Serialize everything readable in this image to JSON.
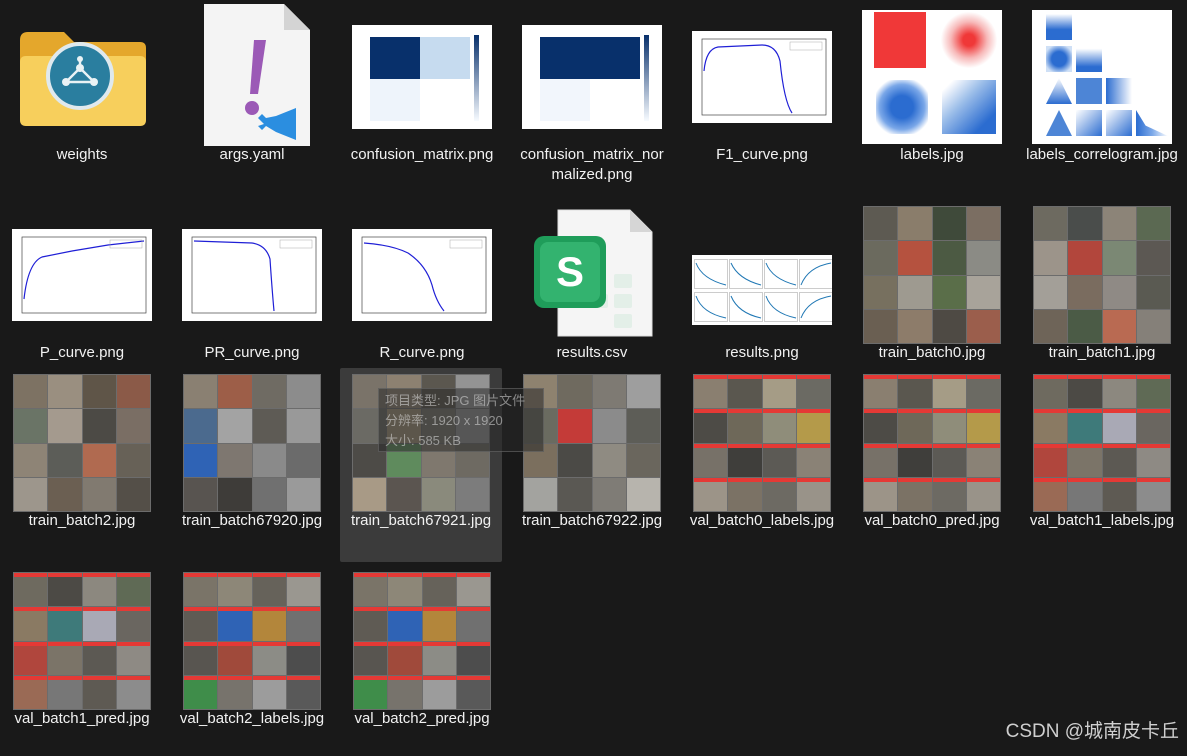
{
  "files": [
    {
      "name": "weights"
    },
    {
      "name": "args.yaml"
    },
    {
      "name": "confusion_matrix.png"
    },
    {
      "name": "confusion_matrix_normalized.png"
    },
    {
      "name": "F1_curve.png"
    },
    {
      "name": "labels.jpg"
    },
    {
      "name": "labels_correlogram.jpg"
    },
    {
      "name": "P_curve.png"
    },
    {
      "name": "PR_curve.png"
    },
    {
      "name": "R_curve.png"
    },
    {
      "name": "results.csv"
    },
    {
      "name": "results.png"
    },
    {
      "name": "train_batch0.jpg"
    },
    {
      "name": "train_batch1.jpg"
    },
    {
      "name": "train_batch2.jpg"
    },
    {
      "name": "train_batch67920.jpg"
    },
    {
      "name": "train_batch67921.jpg"
    },
    {
      "name": "train_batch67922.jpg"
    },
    {
      "name": "val_batch0_labels.jpg"
    },
    {
      "name": "val_batch0_pred.jpg"
    },
    {
      "name": "val_batch1_labels.jpg"
    },
    {
      "name": "val_batch1_pred.jpg"
    },
    {
      "name": "val_batch2_labels.jpg"
    },
    {
      "name": "val_batch2_pred.jpg"
    }
  ],
  "tooltip": {
    "type_line": "项目类型: JPG 图片文件",
    "dims_line": "分辨率: 1920 x 1920",
    "size_line": "大小: 585 KB"
  },
  "watermark": "CSDN @城南皮卡丘",
  "colors": {
    "background": "#191919",
    "selection": "#3b3b3b",
    "folder": "#f3c04e",
    "vscode_blue": "#2b8ee0",
    "yaml_purple": "#9b59b6",
    "sheets_green": "#1f9d5a",
    "matrix_dark": "#08306b",
    "curve_blue": "#1f1fd6",
    "label_red": "#e53935"
  }
}
